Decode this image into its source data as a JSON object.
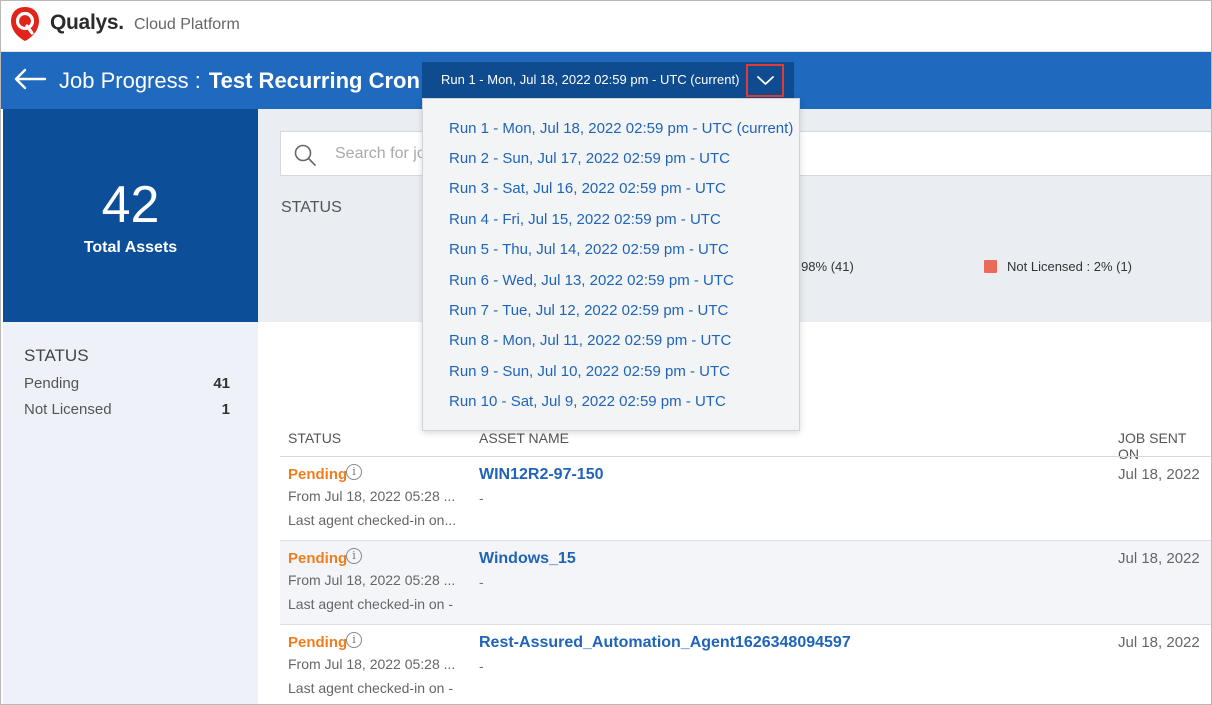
{
  "brand": {
    "name": "Qualys.",
    "sub": "Cloud Platform",
    "color": "#e2231a"
  },
  "header": {
    "title_label": "Job Progress :",
    "job_name": "Test Recurring Cron",
    "selected_run": "Run 1 - Mon, Jul 18, 2022 02:59 pm - UTC (current)",
    "bg_color": "#1f69be"
  },
  "runs": [
    "Run 1 - Mon, Jul 18, 2022 02:59 pm - UTC (current)",
    "Run 2 - Sun, Jul 17, 2022 02:59 pm - UTC",
    "Run 3 - Sat, Jul 16, 2022 02:59 pm - UTC",
    "Run 4 - Fri, Jul 15, 2022 02:59 pm - UTC",
    "Run 5 - Thu, Jul 14, 2022 02:59 pm - UTC",
    "Run 6 - Wed, Jul 13, 2022 02:59 pm - UTC",
    "Run 7 - Tue, Jul 12, 2022 02:59 pm - UTC",
    "Run 8 - Mon, Jul 11, 2022 02:59 pm - UTC",
    "Run 9 - Sun, Jul 10, 2022 02:59 pm - UTC",
    "Run 10 - Sat, Jul 9, 2022 02:59 pm - UTC"
  ],
  "summary": {
    "total": "42",
    "total_label": "Total Assets"
  },
  "left_status": {
    "title": "STATUS",
    "items": [
      {
        "label": "Pending",
        "count": "41"
      },
      {
        "label": "Not Licensed",
        "count": "1"
      }
    ]
  },
  "search": {
    "placeholder": "Search for jo"
  },
  "status_chart": {
    "title": "STATUS",
    "pending_legend": "g : 98% (41)",
    "not_licensed_legend": "Not Licensed : 2% (1)",
    "not_licensed_color": "#ea6b5c"
  },
  "table": {
    "columns": [
      "STATUS",
      "ASSET NAME",
      "JOB SENT ON"
    ],
    "rows": [
      {
        "status": "Pending",
        "from": "From Jul 18, 2022 05:28 ...",
        "last": "Last agent checked-in on...",
        "asset": "WIN12R2-97-150",
        "sub": "-",
        "sent": "Jul 18, 2022"
      },
      {
        "status": "Pending",
        "from": "From Jul 18, 2022 05:28 ...",
        "last": "Last agent checked-in on -",
        "asset": "Windows_15",
        "sub": "-",
        "sent": "Jul 18, 2022"
      },
      {
        "status": "Pending",
        "from": "From Jul 18, 2022 05:28 ...",
        "last": "Last agent checked-in on -",
        "asset": "Rest-Assured_Automation_Agent1626348094597",
        "sub": "-",
        "sent": "Jul 18, 2022"
      }
    ]
  }
}
